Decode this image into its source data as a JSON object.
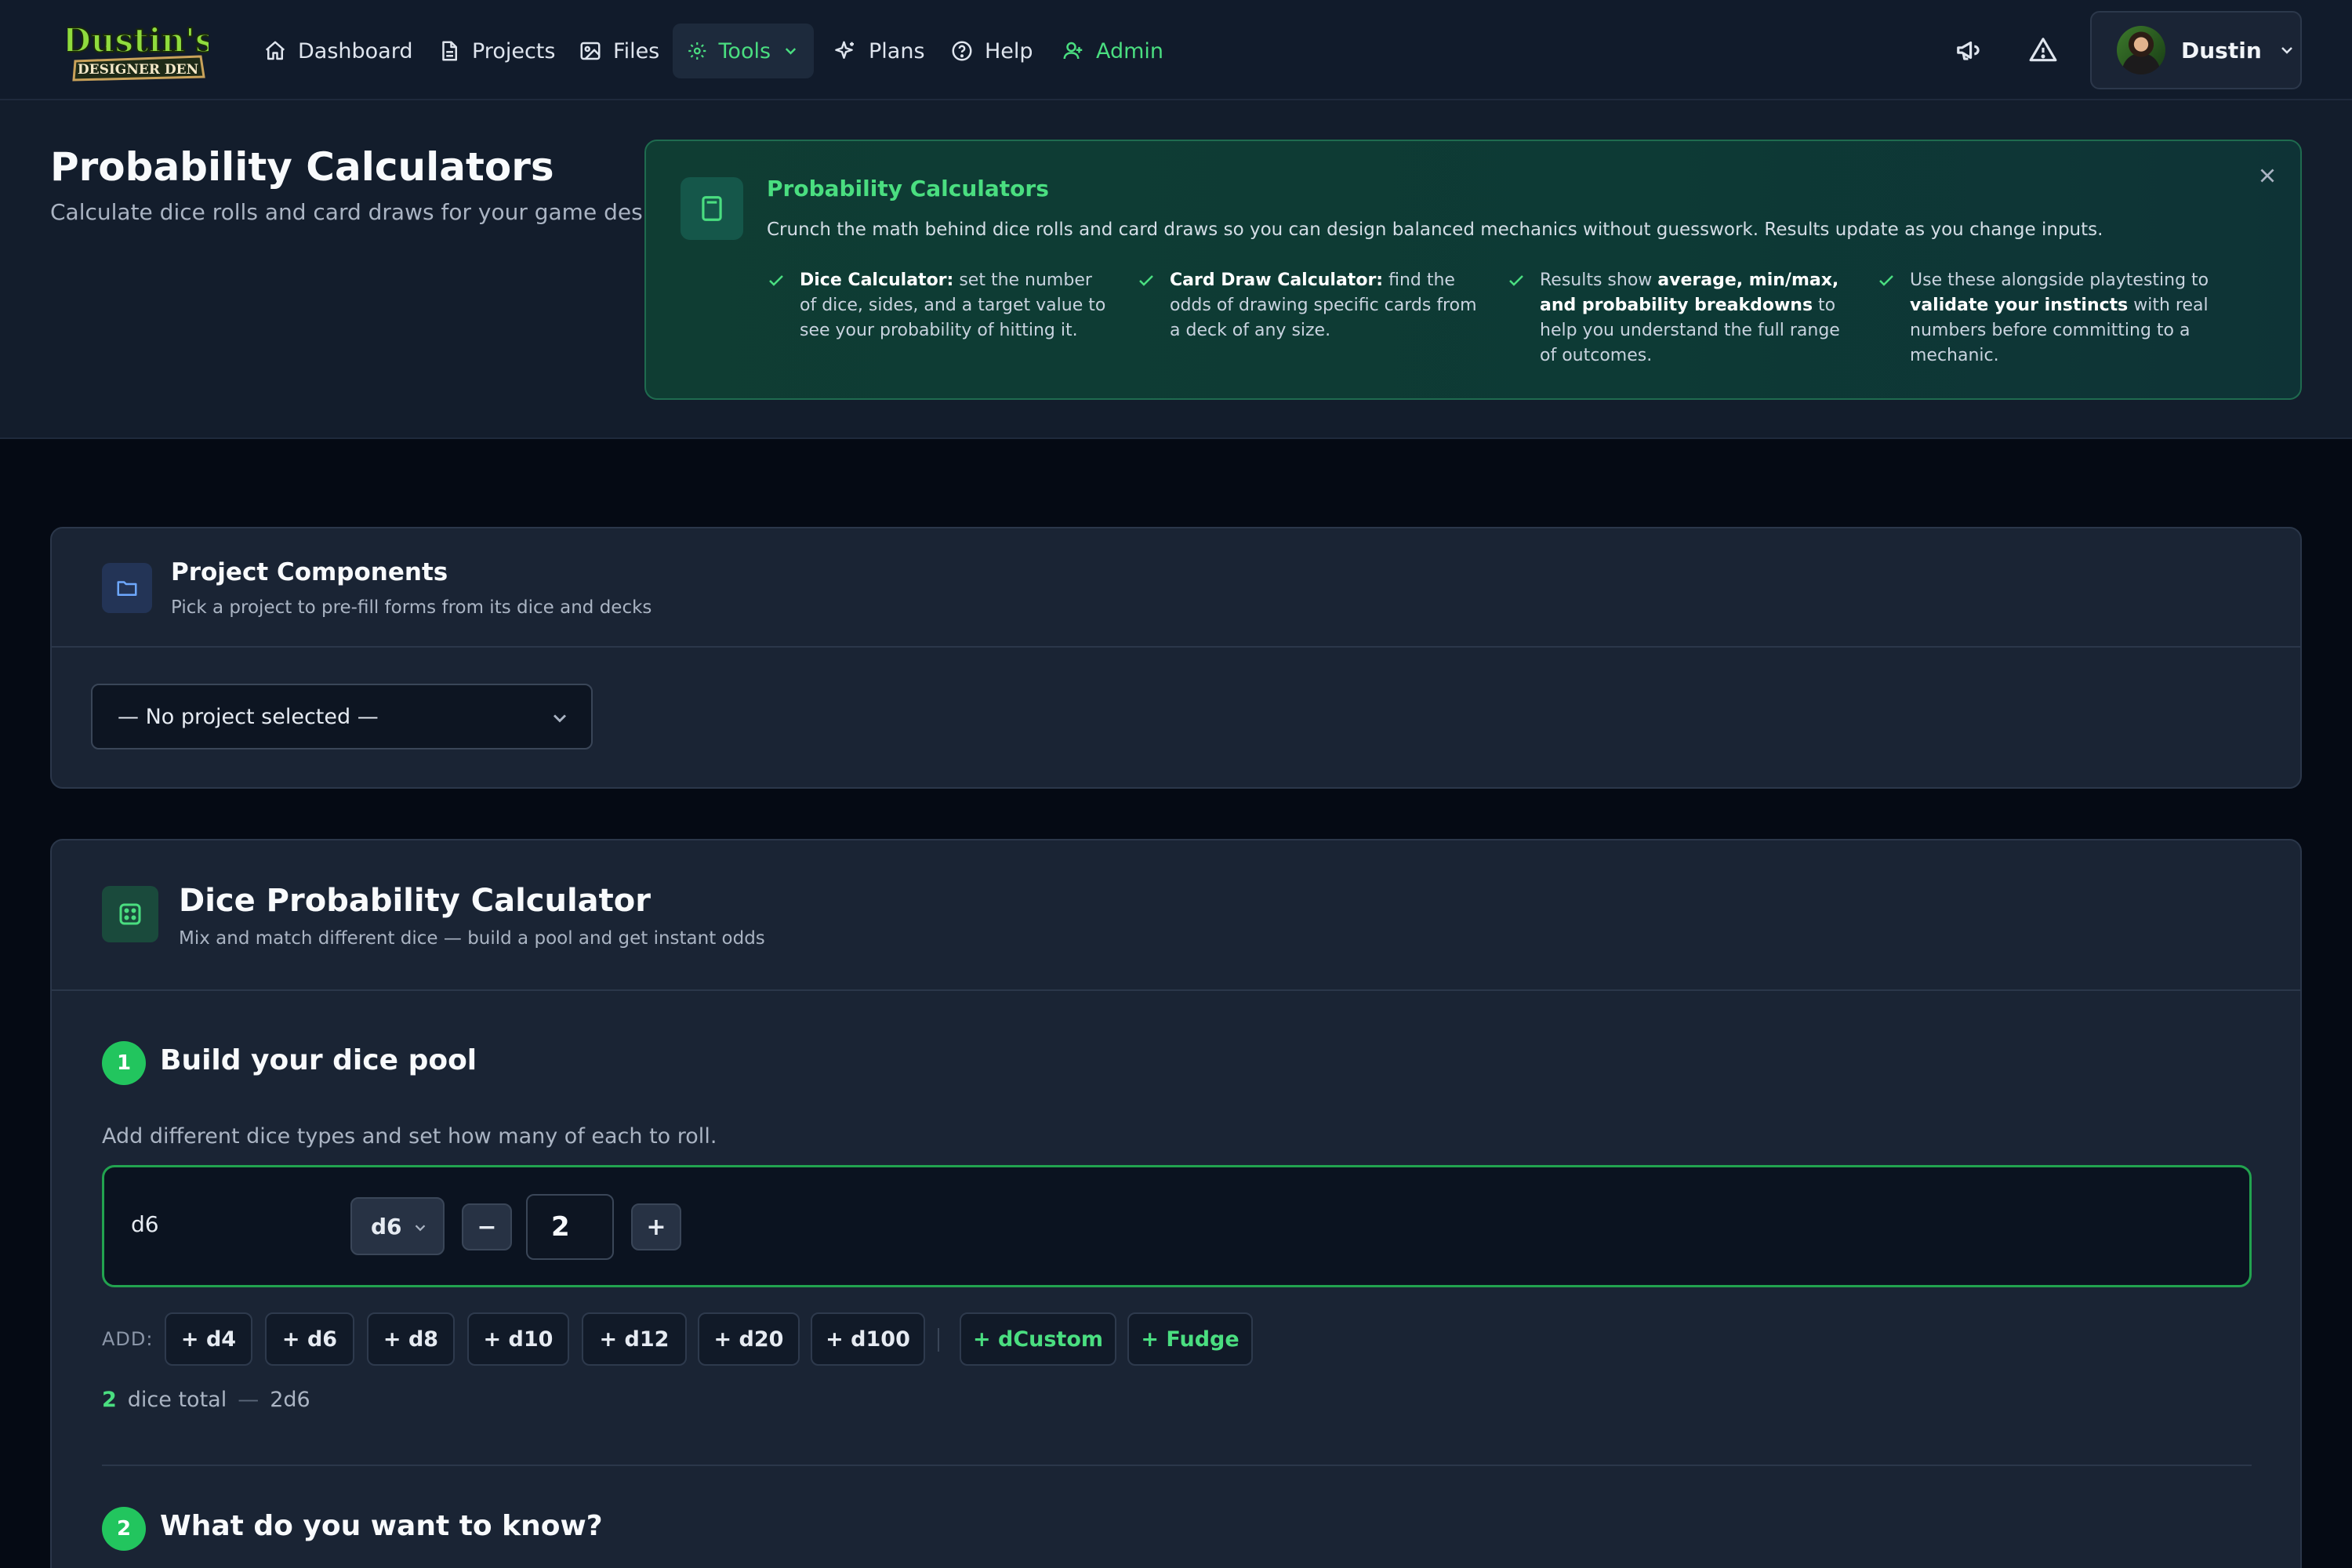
{
  "nav": {
    "logo_line1": "Dustin's",
    "logo_line2": "DESIGNER DEN",
    "links": [
      {
        "label": "Dashboard",
        "icon": "home-icon"
      },
      {
        "label": "Projects",
        "icon": "document-icon"
      },
      {
        "label": "Files",
        "icon": "image-icon"
      },
      {
        "label": "Tools",
        "icon": "gear-icon",
        "active": true
      },
      {
        "label": "Plans",
        "icon": "sparkles-icon"
      },
      {
        "label": "Help",
        "icon": "help-circle-icon"
      },
      {
        "label": "Admin",
        "icon": "users-icon"
      }
    ],
    "user_name": "Dustin"
  },
  "header": {
    "title": "Probability Calculators",
    "subtitle": "Calculate dice rolls and card draws for your game designs",
    "info": {
      "title": "Probability Calculators",
      "description": "Crunch the math behind dice rolls and card draws so you can design balanced mechanics without guesswork. Results update as you change inputs.",
      "tips": [
        {
          "bold": "Dice Calculator:",
          "text": " set the number of dice, sides, and a target value to see your probability of hitting it."
        },
        {
          "bold": "Card Draw Calculator:",
          "text": " find the odds of drawing specific cards from a deck of any size."
        },
        {
          "pre": "Results show ",
          "bold": "average, min/max, and probability breakdowns",
          "text": " to help you understand the full range of outcomes."
        },
        {
          "pre": "Use these alongside playtesting to ",
          "bold": "validate your instincts",
          "text": " with real numbers before committing to a mechanic."
        }
      ]
    }
  },
  "project_components": {
    "title": "Project Components",
    "subtitle": "Pick a project to pre-fill forms from its dice and decks",
    "select_value": "— No project selected —"
  },
  "dice_calculator": {
    "title": "Dice Probability Calculator",
    "subtitle": "Mix and match different dice — build a pool and get instant odds",
    "step1": {
      "number": "1",
      "title": "Build your dice pool",
      "description": "Add different dice types and set how many of each to roll.",
      "pool": [
        {
          "label": "d6",
          "die_type": "d6",
          "quantity": "2"
        }
      ],
      "minus_label": "−",
      "plus_label": "+",
      "add_label": "ADD:",
      "add_buttons": [
        "+ d4",
        "+ d6",
        "+ d8",
        "+ d10",
        "+ d12",
        "+ d20",
        "+ d100"
      ],
      "special_buttons": [
        "+ dCustom",
        "+ Fudge"
      ],
      "total_count": "2",
      "total_label": "dice total",
      "total_dash": "—",
      "total_formula": "2d6"
    },
    "step2": {
      "number": "2",
      "title": "What do you want to know?"
    }
  },
  "colors": {
    "accent": "#4ade80",
    "badge": "#22c55e",
    "background": "#050a14",
    "panel": "#1a2434"
  }
}
